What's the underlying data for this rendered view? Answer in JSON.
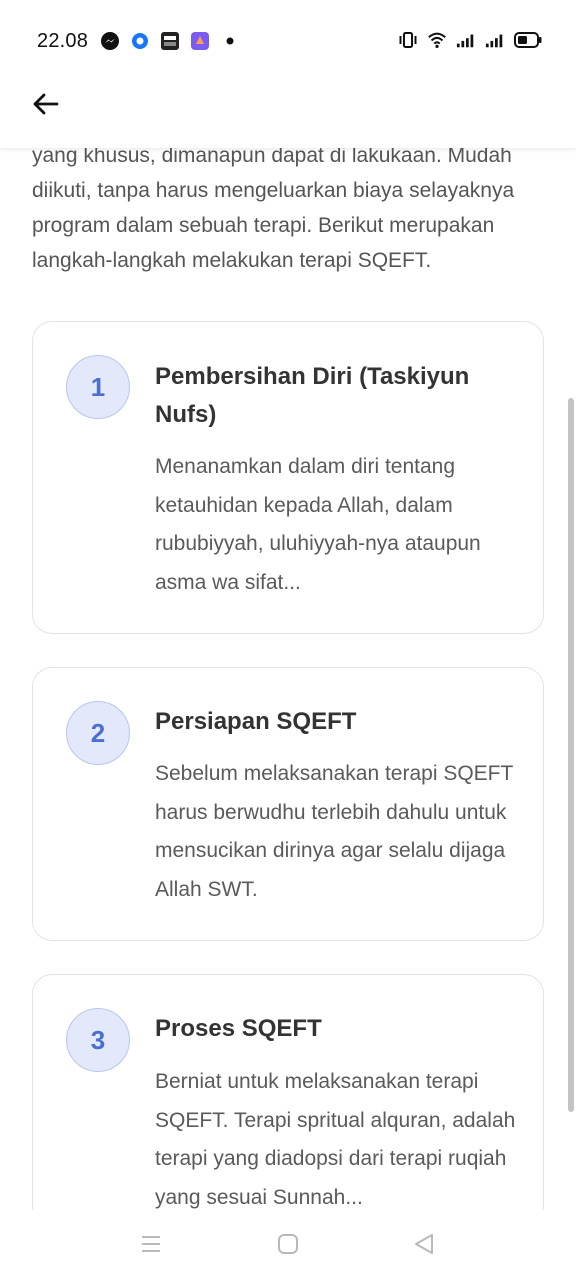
{
  "status_bar": {
    "time": "22.08",
    "left_icons": [
      "messenger-icon",
      "chat-bubble-icon",
      "bri-mo-icon",
      "shortcut-app-icon",
      "dot-icon"
    ],
    "right_icons": [
      "vibrate-icon",
      "wifi-icon",
      "signal-1-icon",
      "signal-2-icon",
      "battery-icon"
    ]
  },
  "header": {
    "back_icon": "arrow-left-icon"
  },
  "intro": {
    "text": "yang khusus, dimanapun dapat di lakukaan. Mudah diikuti, tanpa harus mengeluarkan biaya selayaknya program dalam sebuah terapi. Berikut merupakan langkah-langkah melakukan terapi SQEFT."
  },
  "steps": [
    {
      "number": "1",
      "title": "Pembersihan Diri (Taskiyun Nufs)",
      "body": "Menanamkan dalam diri tentang ketauhidan kepada Allah, dalam rububiyyah, uluhiyyah-nya  ataupun asma wa sifat..."
    },
    {
      "number": "2",
      "title": "Persiapan SQEFT",
      "body": "Sebelum melaksanakan terapi SQEFT harus berwudhu terlebih dahulu untuk mensucikan dirinya agar selalu dijaga Allah SWT."
    },
    {
      "number": "3",
      "title": "Proses SQEFT",
      "body": "Berniat untuk melaksanakan terapi SQEFT.  Terapi spritual alquran, adalah terapi yang diadopsi dari terapi ruqiah yang sesuai Sunnah..."
    }
  ],
  "nav_bar": {
    "icons": [
      "menu-icon",
      "home-square-icon",
      "back-triangle-icon"
    ]
  },
  "colors": {
    "badge_bg": "#e3e9fb",
    "badge_text": "#4a6fd0",
    "text_body": "#5a5a5a"
  }
}
